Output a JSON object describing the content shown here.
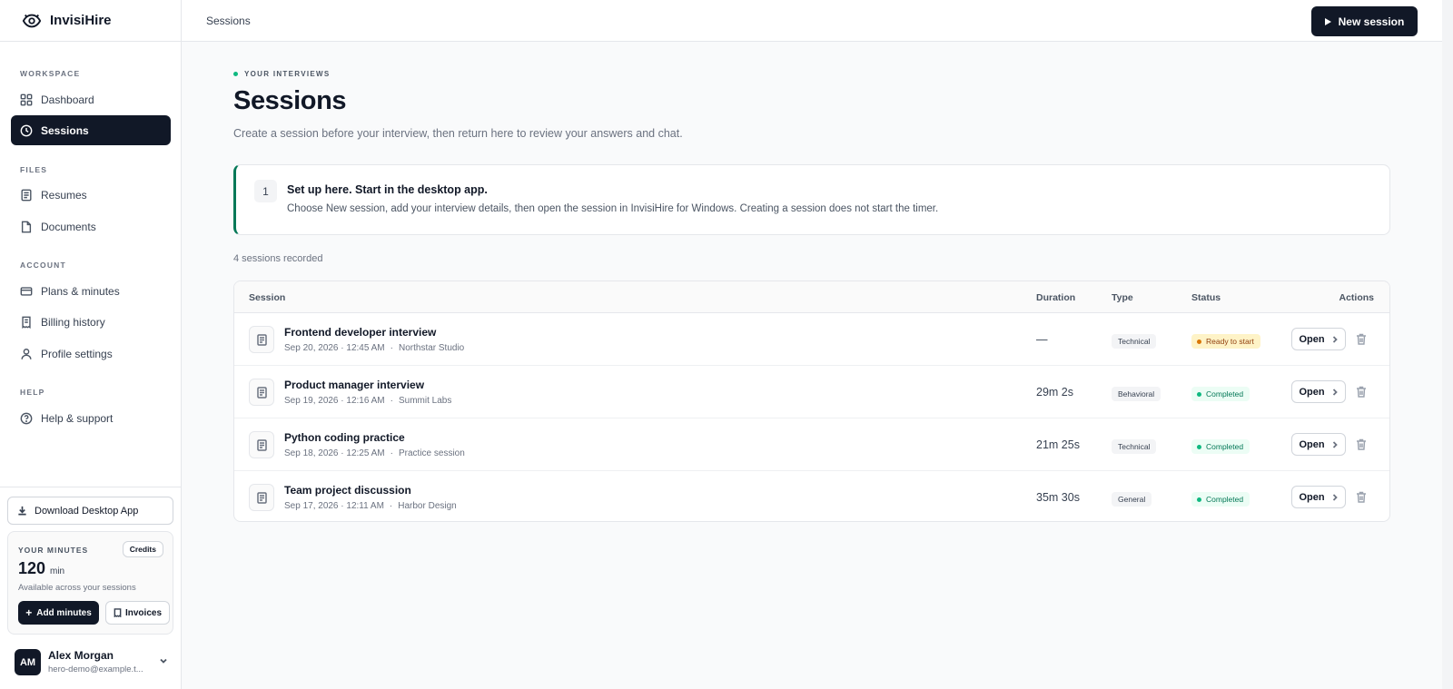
{
  "brand": {
    "name": "InvisiHire"
  },
  "sidebar": {
    "sections": [
      {
        "label": "WORKSPACE"
      },
      {
        "label": "FILES"
      },
      {
        "label": "ACCOUNT"
      },
      {
        "label": "HELP"
      }
    ],
    "items": [
      {
        "label": "Dashboard",
        "icon": "grid-icon"
      },
      {
        "label": "Sessions",
        "icon": "clock-icon",
        "active": true
      },
      {
        "label": "Resumes",
        "icon": "file-text-icon"
      },
      {
        "label": "Documents",
        "icon": "document-icon"
      },
      {
        "label": "Plans & minutes",
        "icon": "credit-card-icon"
      },
      {
        "label": "Billing history",
        "icon": "receipt-icon"
      },
      {
        "label": "Profile settings",
        "icon": "user-icon"
      },
      {
        "label": "Help & support",
        "icon": "help-circle-icon"
      }
    ],
    "download_label": "Download Desktop App",
    "minutes": {
      "label": "YOUR MINUTES",
      "credits_label": "Credits",
      "value": "120",
      "unit": "min",
      "subtitle": "Available across your sessions",
      "add_label": "Add minutes",
      "invoices_label": "Invoices"
    },
    "user": {
      "initials": "AM",
      "name": "Alex Morgan",
      "email": "hero-demo@example.t..."
    }
  },
  "header": {
    "breadcrumb": "Sessions",
    "new_session_label": "New session"
  },
  "main": {
    "eyebrow": "YOUR INTERVIEWS",
    "title": "Sessions",
    "subtitle": "Create a session before your interview, then return here to review your answers and chat.",
    "setup": {
      "step": "1",
      "title": "Set up here. Start in the desktop app.",
      "description": "Choose New session, add your interview details, then open the session in InvisiHire for Windows. Creating a session does not start the timer."
    },
    "count_text": "4 sessions recorded",
    "table": {
      "columns": {
        "session": "Session",
        "duration": "Duration",
        "type": "Type",
        "status": "Status",
        "actions": "Actions"
      },
      "rows": [
        {
          "title": "Frontend developer interview",
          "date": "Sep 20, 2026 · 12:45 AM",
          "company": "Northstar Studio",
          "duration": "—",
          "type": "Technical",
          "status": "Ready to start",
          "open_label": "Open"
        },
        {
          "title": "Product manager interview",
          "date": "Sep 19, 2026 · 12:16 AM",
          "company": "Summit Labs",
          "duration": "29m 2s",
          "type": "Behavioral",
          "status": "Completed",
          "open_label": "Open"
        },
        {
          "title": "Python coding practice",
          "date": "Sep 18, 2026 · 12:25 AM",
          "company": "Practice session",
          "duration": "21m 25s",
          "type": "Technical",
          "status": "Completed",
          "open_label": "Open"
        },
        {
          "title": "Team project discussion",
          "date": "Sep 17, 2026 · 12:11 AM",
          "company": "Harbor Design",
          "duration": "35m 30s",
          "type": "General",
          "status": "Completed",
          "open_label": "Open"
        }
      ]
    }
  },
  "colors": {
    "primary": "#111827",
    "accent_green": "#047857",
    "ready": "#d97706",
    "completed": "#10b981"
  }
}
